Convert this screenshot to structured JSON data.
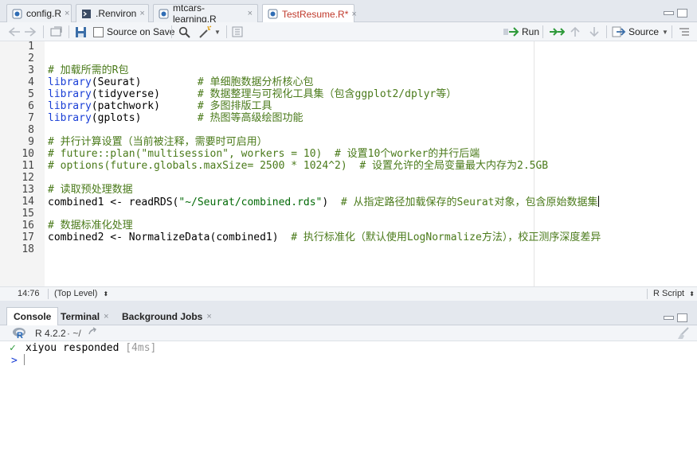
{
  "editor_tabs": [
    {
      "label": "config.R",
      "icon": "r-file-icon",
      "close": "×"
    },
    {
      "label": ".Renviron",
      "icon": "text-file-icon",
      "close": "×"
    },
    {
      "label": "mtcars-learning.R",
      "icon": "r-file-icon",
      "close": "×"
    },
    {
      "label": "TestResume.R*",
      "icon": "r-file-icon",
      "close": "×"
    }
  ],
  "toolbar": {
    "source_on_save": "Source on Save",
    "run": "Run",
    "source": "Source"
  },
  "line_numbers": [
    "1",
    "2",
    "3",
    "4",
    "5",
    "6",
    "7",
    "8",
    "9",
    "10",
    "11",
    "12",
    "13",
    "14",
    "15",
    "16",
    "17",
    "18"
  ],
  "code": {
    "l3": "# 加载所需的R包",
    "l4_kw": "library",
    "l4_arg": "(Seurat)",
    "l4_pad": "         ",
    "l4_cm": "# 单细胞数据分析核心包",
    "l5_kw": "library",
    "l5_arg": "(tidyverse)",
    "l5_pad": "      ",
    "l5_cm": "# 数据整理与可视化工具集（包含ggplot2/dplyr等）",
    "l6_kw": "library",
    "l6_arg": "(patchwork)",
    "l6_pad": "      ",
    "l6_cm": "# 多图排版工具",
    "l7_kw": "library",
    "l7_arg": "(gplots)",
    "l7_pad": "         ",
    "l7_cm": "# 热图等高级绘图功能",
    "l9": "# 并行计算设置（当前被注释，需要时可启用）",
    "l10": "# future::plan(\"multisession\", workers = 10)  # 设置10个worker的并行后端",
    "l11": "# options(future.globals.maxSize= 2500 * 1024^2)  # 设置允许的全局变量最大内存为2.5GB",
    "l13": "# 读取预处理数据",
    "l14_code": "combined1 <- readRDS(",
    "l14_str": "\"~/Seurat/combined.rds\"",
    "l14_close": ")  ",
    "l14_cm": "# 从指定路径加载保存的Seurat对象，包含原始数据集",
    "l16": "# 数据标准化处理",
    "l17_code": "combined2 <- NormalizeData(combined1)  ",
    "l17_cm": "# 执行标准化（默认使用LogNormalize方法），校正测序深度差异"
  },
  "status": {
    "position": "14:76",
    "scope": "(Top Level)",
    "file_type": "R Script"
  },
  "console_tabs": [
    {
      "label": "Console",
      "close": ""
    },
    {
      "label": "Terminal",
      "close": "×"
    },
    {
      "label": "Background Jobs",
      "close": "×"
    }
  ],
  "console": {
    "r_version": "R 4.2.2",
    "path": "· ~/",
    "check": "✓",
    "message": "xiyou responded",
    "timing": "[4ms]",
    "prompt": ">"
  },
  "colors": {
    "accent_tab": "#c0392b",
    "comment": "#4a7a1a",
    "keyword": "#1a3fd6",
    "string": "#036a07",
    "run_green": "#2e9a3a"
  }
}
